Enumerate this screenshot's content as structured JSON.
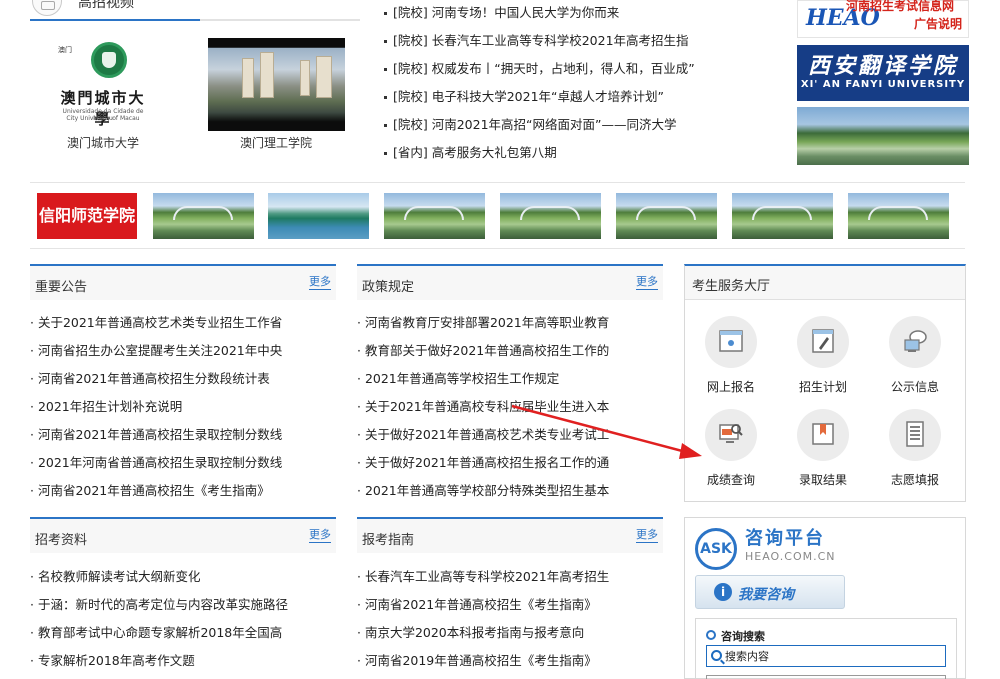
{
  "gallery": {
    "title": "高招视频",
    "more_dots": "···",
    "cards": [
      {
        "caption": "澳门城市大学",
        "logo": {
          "tag": "澳门",
          "cn": "澳門城市大學",
          "pt": "Universidade da Cidade de Macau",
          "en": "City University of Macau"
        }
      },
      {
        "caption": "澳门理工学院"
      }
    ]
  },
  "news": [
    "[院校] 河南专场！中国人民大学为你而来",
    "[院校] 长春汽车工业高等专科学校2021年高考招生指",
    "[院校] 权威发布丨“拥天时，占地利，得人和，百业成”",
    "[院校] 电子科技大学2021年“卓越人才培养计划”",
    "[院校] 河南2021年高招“网络面对面”——同济大学",
    "[省内] 高考服务大礼包第八期"
  ],
  "ads": {
    "top_logo": "HEAO",
    "top_line1": "河南招生考试信息网",
    "top_line2": "广告说明",
    "xafy_cn": "西安翻译学院",
    "xafy_en": "XI' AN FANYI UNIVERSITY"
  },
  "banner": {
    "logo_text": "信阳师范学院"
  },
  "panels": {
    "notices": {
      "title": "重要公告",
      "more": "更多",
      "items": [
        "关于2021年普通高校艺术类专业招生工作省",
        "河南省招生办公室提醒考生关注2021年中央",
        "河南省2021年普通高校招生分数段统计表",
        "2021年招生计划补充说明",
        "河南省2021年普通高校招生录取控制分数线",
        "2021年河南省普通高校招生录取控制分数线",
        "河南省2021年普通高校招生《考生指南》"
      ]
    },
    "policy": {
      "title": "政策规定",
      "more": "更多",
      "items": [
        "河南省教育厅安排部署2021年高等职业教育",
        "教育部关于做好2021年普通高校招生工作的",
        "2021年普通高等学校招生工作规定",
        "关于2021年普通高校专科应届毕业生进入本",
        "关于做好2021年普通高校艺术类专业考试工",
        "关于做好2021年普通高校招生报名工作的通",
        "2021年普通高等学校部分特殊类型招生基本"
      ]
    },
    "materials": {
      "title": "招考资料",
      "more": "更多",
      "items": [
        "名校教师解读考试大纲新变化",
        "于涵：新时代的高考定位与内容改革实施路径",
        "教育部考试中心命题专家解析2018年全国高",
        "专家解析2018年高考作文题"
      ]
    },
    "guide": {
      "title": "报考指南",
      "more": "更多",
      "items": [
        "长春汽车工业高等专科学校2021年高考招生",
        "河南省2021年普通高校招生《考生指南》",
        "南京大学2020本科报考指南与报考意向",
        "河南省2019年普通高校招生《考生指南》"
      ]
    }
  },
  "services": {
    "title": "考生服务大厅",
    "items": [
      {
        "label": "网上报名",
        "icon": "monitor-icon"
      },
      {
        "label": "招生计划",
        "icon": "pen-doc-icon"
      },
      {
        "label": "公示信息",
        "icon": "speech-bubble-icon"
      },
      {
        "label": "成绩查询",
        "icon": "screen-magnifier-icon"
      },
      {
        "label": "录取结果",
        "icon": "bookmark-doc-icon"
      },
      {
        "label": "志愿填报",
        "icon": "list-doc-icon"
      }
    ]
  },
  "consult": {
    "badge": "ASK",
    "title": "咨询平台",
    "domain": "HEAO.COM.CN",
    "button_icon": "i",
    "button": "我要咨询",
    "search_heading": "咨询搜索",
    "search_placeholder": "搜索内容"
  },
  "colors": {
    "accent": "#2b74c6",
    "banner_red": "#d9191d",
    "arrow_red": "#e02020",
    "xafy_blue": "#163d86"
  }
}
